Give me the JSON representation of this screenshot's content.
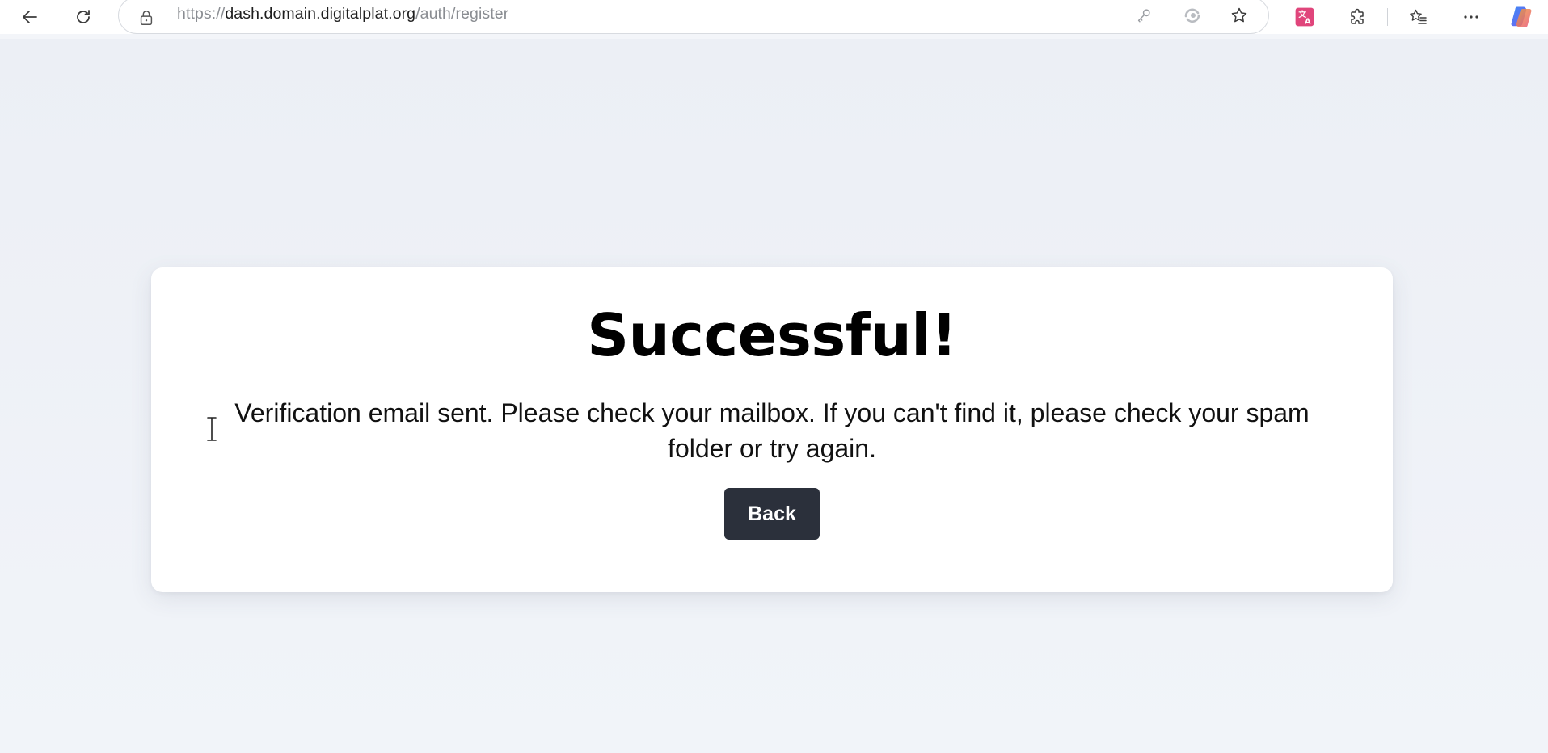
{
  "browser": {
    "url_prefix": "https://",
    "url_host": "dash.domain.digitalplat.org",
    "url_path": "/auth/register",
    "icons": {
      "back": "back-arrow-icon",
      "refresh": "refresh-icon",
      "lock": "lock-icon",
      "password": "key-icon",
      "edge_rewards": "rewards-icon",
      "favorite": "star-icon",
      "translate": "translate-icon",
      "extensions": "puzzle-icon",
      "favorites": "favorites-icon",
      "menu": "more-icon",
      "copilot": "copilot-icon"
    }
  },
  "card": {
    "title": "Successful!",
    "message": "Verification email sent. Please check your mailbox. If you can't find it, please check your spam folder or try again.",
    "back_label": "Back"
  },
  "colors": {
    "page_background": "#eef1f6",
    "card_background": "#ffffff",
    "button_background": "#2b303b",
    "button_text": "#ffffff",
    "translate_accent": "#e0457b"
  }
}
